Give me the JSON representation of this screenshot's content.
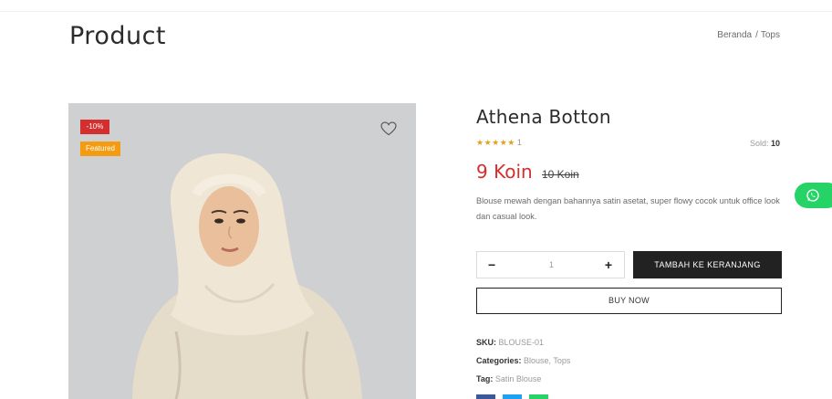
{
  "header": {
    "title": "Product"
  },
  "breadcrumb": {
    "home": "Beranda",
    "separator": "/",
    "current": "Tops"
  },
  "product": {
    "badges": {
      "discount": "-10%",
      "featured": "Featured"
    },
    "name": "Athena Botton",
    "rating": {
      "stars": "★★★★★",
      "count": "1"
    },
    "sold": {
      "label": "Sold:",
      "value": "10"
    },
    "price": "9 Koin",
    "old_price": "10 Koin",
    "description": "Blouse mewah dengan bahannya satin asetat, super flowy cocok untuk office look dan casual look.",
    "quantity": {
      "minus": "−",
      "value": "1",
      "plus": "+"
    },
    "add_to_cart": "TAMBAH KE KERANJANG",
    "buy_now": "BUY NOW",
    "meta": {
      "sku_label": "SKU:",
      "sku": "BLOUSE-01",
      "categories_label": "Categories:",
      "categories": "Blouse, Tops",
      "tag_label": "Tag:",
      "tag": "Satin Blouse"
    }
  },
  "icons": {
    "wishlist": "heart-icon",
    "whatsapp": "whatsapp-icon",
    "share": [
      "facebook-icon",
      "twitter-icon",
      "whatsapp-icon"
    ]
  },
  "colors": {
    "discount": "#d32f2f",
    "featured": "#f39c12",
    "price": "#d32f2f",
    "button": "#222222",
    "whatsapp": "#25d366",
    "stars": "#e4a11b"
  }
}
